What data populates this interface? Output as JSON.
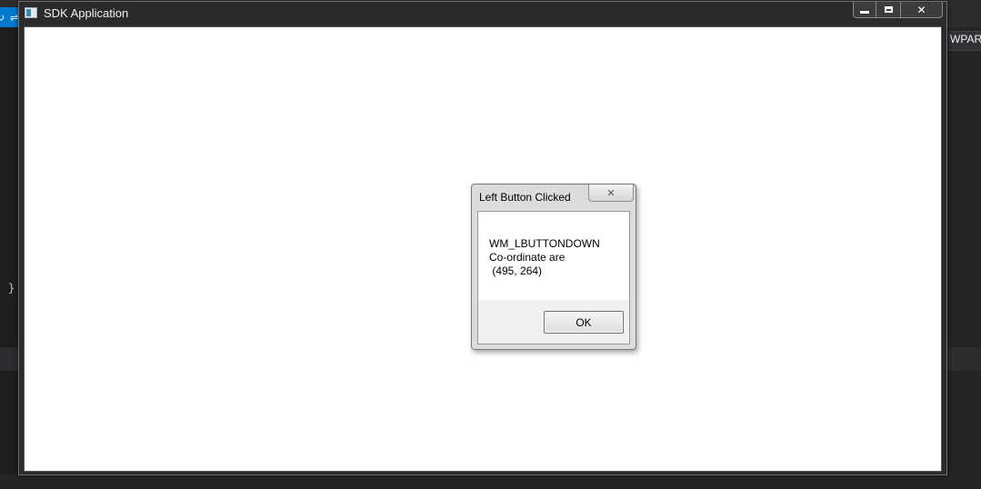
{
  "background": {
    "tab_glyphs": [
      "↻",
      "⇌"
    ],
    "right_panel_text": "WPARA",
    "left_code_text": "}"
  },
  "window": {
    "title": "SDK Application",
    "icon": "app-window-icon",
    "minimize_icon": "minimize-icon",
    "maximize_icon": "maximize-icon",
    "close_icon": "close-icon",
    "close_glyph": "✕"
  },
  "dialog": {
    "title": "Left Button Clicked",
    "close_glyph": "✕",
    "message": "WM_LBUTTONDOWN\nCo-ordinate are\n (495, 264)",
    "ok_label": "OK"
  }
}
